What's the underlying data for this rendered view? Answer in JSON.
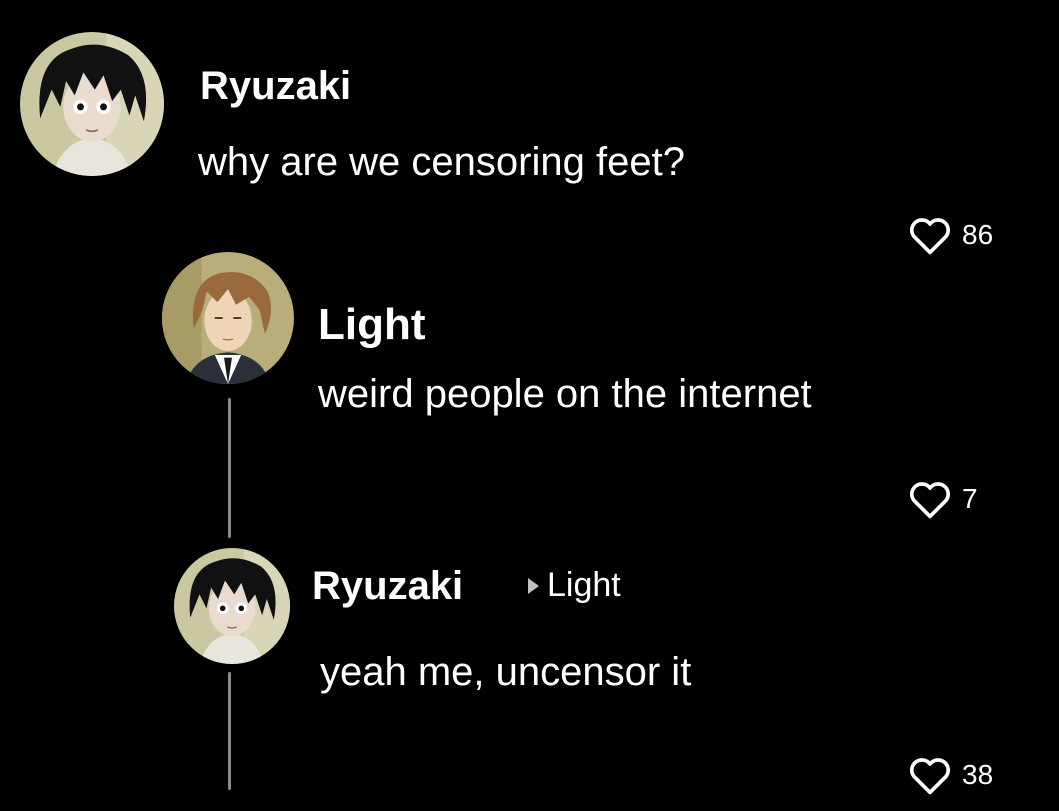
{
  "comments": [
    {
      "username": "Ryuzaki",
      "text": "why are we censoring feet?",
      "likes": "86",
      "avatar_icon": "ryuzaki-avatar-icon"
    },
    {
      "username": "Light",
      "text": "weird people on the internet",
      "likes": "7",
      "avatar_icon": "light-avatar-icon"
    },
    {
      "username": "Ryuzaki",
      "reply_to": "Light",
      "text": "yeah me, uncensor it",
      "likes": "38",
      "avatar_icon": "ryuzaki-avatar-icon"
    }
  ],
  "icons": {
    "like": "heart-outline-icon",
    "reply_indicator": "play-triangle-icon"
  },
  "colors": {
    "background": "#000000",
    "text": "#ffffff",
    "thread_line": "#8a8a8a"
  }
}
